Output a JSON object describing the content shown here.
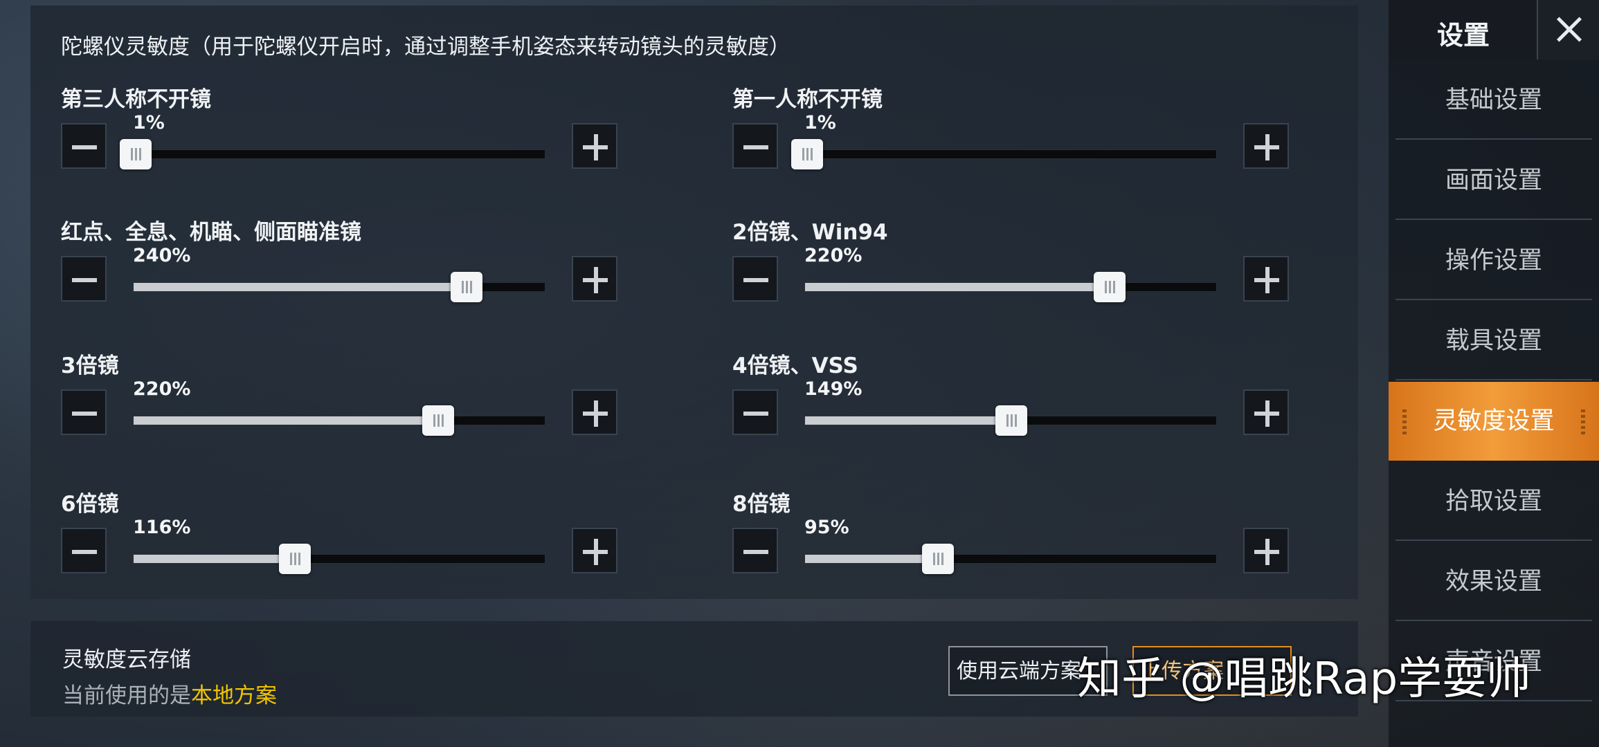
{
  "panel": {
    "title": "陀螺仪灵敏度（用于陀螺仪开启时，通过调整手机姿态来转动镜头的灵敏度）",
    "sliders": [
      {
        "label": "第三人称不开镜",
        "value_text": "1%",
        "fraction": 0.0
      },
      {
        "label": "第一人称不开镜",
        "value_text": "1%",
        "fraction": 0.0
      },
      {
        "label": "红点、全息、机瞄、侧面瞄准镜",
        "value_text": "240%",
        "fraction": 0.81
      },
      {
        "label": "2倍镜、Win94",
        "value_text": "220%",
        "fraction": 0.74
      },
      {
        "label": "3倍镜",
        "value_text": "220%",
        "fraction": 0.74
      },
      {
        "label": "4倍镜、VSS",
        "value_text": "149%",
        "fraction": 0.5
      },
      {
        "label": "6倍镜",
        "value_text": "116%",
        "fraction": 0.39
      },
      {
        "label": "8倍镜",
        "value_text": "95%",
        "fraction": 0.32
      }
    ]
  },
  "cloud": {
    "title": "灵敏度云存储",
    "current_prefix": "当前使用的是",
    "current_plan": "本地方案",
    "use_cloud_label": "使用云端方案",
    "upload_label": "上传方案"
  },
  "sidebar": {
    "title": "设置",
    "items": [
      {
        "label": "基础设置"
      },
      {
        "label": "画面设置"
      },
      {
        "label": "操作设置"
      },
      {
        "label": "载具设置"
      },
      {
        "label": "灵敏度设置",
        "active": true
      },
      {
        "label": "拾取设置"
      },
      {
        "label": "效果设置"
      },
      {
        "label": "声音设置"
      }
    ]
  },
  "watermark": "知乎 @唱跳Rap学耍帅",
  "colors": {
    "accent": "#f29c3a",
    "highlight": "#f2c400",
    "upload_border": "#e58d1e"
  }
}
